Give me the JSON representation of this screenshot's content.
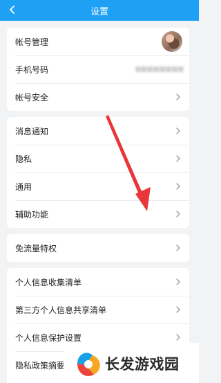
{
  "header": {
    "title": "设置",
    "back_icon": "chevron-left-icon"
  },
  "account_section": {
    "items": [
      {
        "label": "帐号管理"
      },
      {
        "label": "手机号码"
      },
      {
        "label": "帐号安全"
      }
    ]
  },
  "general_section": {
    "items": [
      {
        "label": "消息通知"
      },
      {
        "label": "隐私"
      },
      {
        "label": "通用"
      },
      {
        "label": "辅助功能"
      }
    ]
  },
  "traffic_section": {
    "items": [
      {
        "label": "免流量特权"
      }
    ]
  },
  "privacy_section": {
    "items": [
      {
        "label": "个人信息收集清单"
      },
      {
        "label": "第三方个人信息共享清单"
      },
      {
        "label": "个人信息保护设置"
      },
      {
        "label": "隐私政策摘要"
      }
    ]
  },
  "watermark": {
    "text": "长发游戏园"
  },
  "colors": {
    "header_bg": "#1ea0f5",
    "annotation_arrow": "#e8363a",
    "page_bg": "#f2f3f5"
  }
}
